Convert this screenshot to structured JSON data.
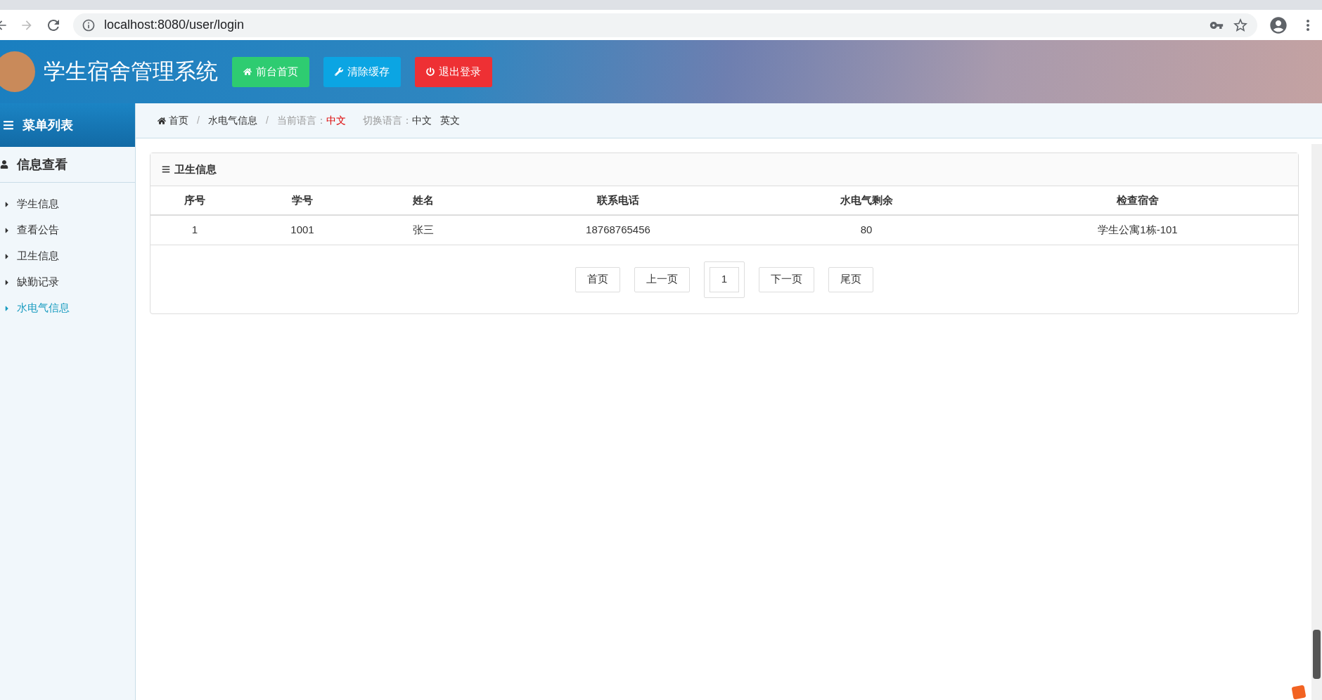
{
  "browser": {
    "url": "localhost:8080/user/login"
  },
  "header": {
    "title": "学生宿舍管理系统",
    "buttons": [
      {
        "label": "前台首页",
        "kind": "home"
      },
      {
        "label": "清除缓存",
        "kind": "wrench"
      },
      {
        "label": "退出登录",
        "kind": "power"
      }
    ]
  },
  "sidebar": {
    "title": "菜单列表",
    "section": "信息查看",
    "items": [
      {
        "label": "学生信息",
        "selected": false
      },
      {
        "label": "查看公告",
        "selected": false
      },
      {
        "label": "卫生信息",
        "selected": false
      },
      {
        "label": "缺勤记录",
        "selected": false
      },
      {
        "label": "水电气信息",
        "selected": true
      }
    ]
  },
  "breadcrumb": {
    "separator": "/",
    "items": [
      "首页",
      "水电气信息"
    ],
    "current_language_label": "当前语言：",
    "current_language": "中文",
    "switch_label": "切换语言：",
    "languages": [
      "中文",
      "英文"
    ]
  },
  "panel": {
    "title": "卫生信息",
    "table": {
      "columns": [
        "序号",
        "学号",
        "姓名",
        "联系电话",
        "水电气剩余",
        "检查宿舍"
      ],
      "rows": [
        [
          "1",
          "1001",
          "张三",
          "18768765456",
          "80",
          "学生公寓1栋-101"
        ]
      ]
    },
    "pagination": {
      "first": "首页",
      "prev": "上一页",
      "page": "1",
      "next": "下一页",
      "last": "尾页"
    }
  }
}
